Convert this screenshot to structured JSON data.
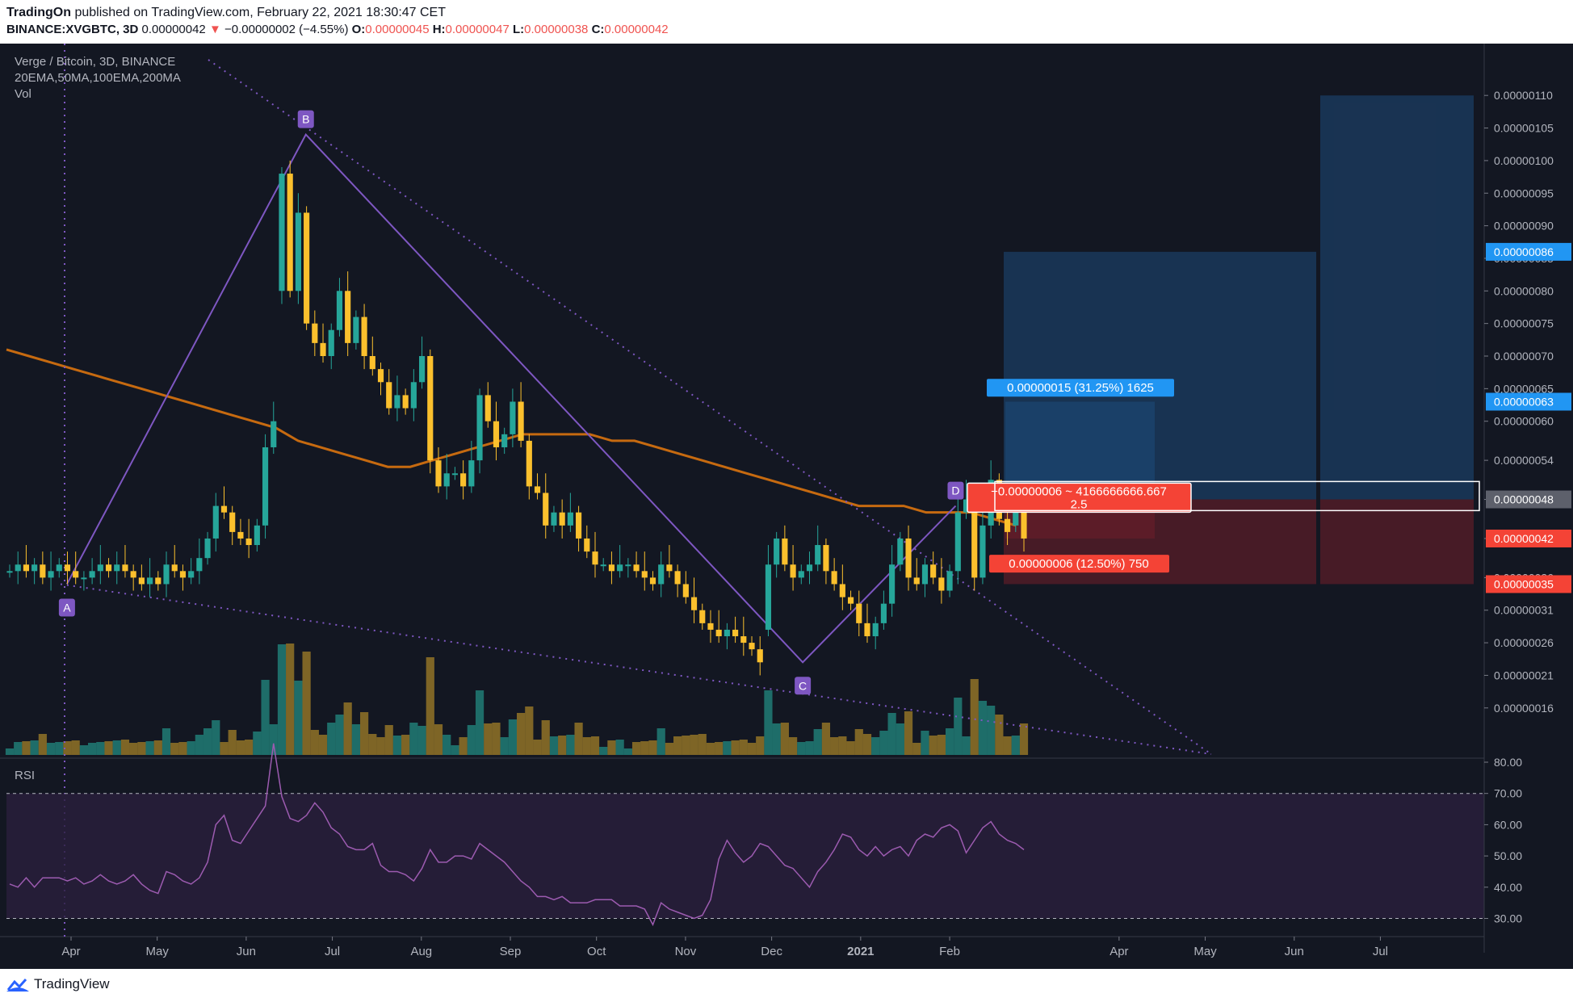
{
  "header": {
    "author": "TradingOn",
    "published_text": "published on TradingView.com, February 22, 2021 18:30:47 CET",
    "symbol": "BINANCE:XVGBTC, 3D",
    "last_price": "0.00000042",
    "change_arrow": "▼",
    "change": "−0.00000002 (−4.55%)",
    "open_label": "O:",
    "open": "0.00000045",
    "high_label": "H:",
    "high": "0.00000047",
    "low_label": "L:",
    "low": "0.00000038",
    "close_label": "C:",
    "close": "0.00000042"
  },
  "legend": {
    "title": "Verge / Bitcoin, 3D, BINANCE",
    "indicators": "20EMA,50MA,100EMA,200MA",
    "volume": "Vol"
  },
  "rsi_label": "RSI",
  "footer": {
    "brand": "TradingView"
  },
  "colors": {
    "background": "#131722",
    "up": "#26a69a",
    "down": "#fbc02d",
    "ma_line": "#c66a10",
    "pattern": "#7e57c2",
    "rsi_line": "#9c5bb0",
    "target_label": "#2196f3",
    "stop_label": "#f44336"
  },
  "position_tool": {
    "target_label": "0.00000015 (31.25%) 1625",
    "stop_label": "0.00000006 (12.50%) 750",
    "center_label_line1": "−0.00000006 ~ 4166666666.667",
    "center_label_line2": "2.5"
  },
  "price_badges": [
    {
      "text": "0.00000086",
      "value": 86,
      "color": "#2196f3"
    },
    {
      "text": "0.00000063",
      "value": 63,
      "color": "#2196f3"
    },
    {
      "text": "0.00000048",
      "value": 48,
      "color": "#5d606b"
    },
    {
      "text": "0.00000042",
      "value": 42,
      "color": "#f44336"
    },
    {
      "text": "0.00000035",
      "value": 35,
      "color": "#f44336"
    }
  ],
  "harmonic_points": [
    {
      "label": "A",
      "date": "2020-03-31",
      "price": 35
    },
    {
      "label": "B",
      "date": "2020-06-14",
      "price": 104
    },
    {
      "label": "C",
      "date": "2020-11-17",
      "price": 23
    },
    {
      "label": "D",
      "date": "2021-01-04",
      "price": 47
    }
  ],
  "chart_data": {
    "type": "candlestick",
    "title": "Verge / Bitcoin, 3D, BINANCE",
    "price_unit": "BTC (values ×1e-8 satoshi)",
    "y_ticks": [
      "0.00000110",
      "0.00000105",
      "0.00000100",
      "0.00000095",
      "0.00000090",
      "0.00000085",
      "0.00000080",
      "0.00000075",
      "0.00000070",
      "0.00000065",
      "0.00000060",
      "0.00000054",
      "0.00000048",
      "0.00000042",
      "0.00000036",
      "0.00000031",
      "0.00000026",
      "0.00000021",
      "0.00000016"
    ],
    "x_ticks": [
      "Apr",
      "May",
      "Jun",
      "Jul",
      "Aug",
      "Sep",
      "Oct",
      "Nov",
      "Dec",
      "2021",
      "Feb",
      "Apr",
      "May",
      "Jun",
      "Jul"
    ],
    "rsi_ticks": [
      "80.00",
      "70.00",
      "60.00",
      "50.00",
      "40.00",
      "30.00"
    ],
    "rsi_levels": [
      70,
      30
    ],
    "ylim": [
      15,
      111
    ],
    "close_sats": [
      37,
      38,
      37,
      38,
      36,
      37,
      38,
      37,
      36,
      36,
      37,
      38,
      37,
      38,
      37,
      36,
      35,
      36,
      35,
      38,
      37,
      36,
      37,
      39,
      42,
      47,
      46,
      43,
      42,
      41,
      44,
      56,
      60,
      98,
      80,
      92,
      75,
      72,
      70,
      74,
      80,
      72,
      76,
      70,
      68,
      66,
      62,
      64,
      62,
      66,
      70,
      54,
      50,
      52,
      52,
      50,
      54,
      64,
      60,
      56,
      58,
      63,
      57,
      50,
      49,
      44,
      46,
      44,
      46,
      42,
      40,
      38,
      38,
      37,
      38,
      38,
      37,
      36,
      35,
      38,
      37,
      35,
      33,
      31,
      29,
      28,
      27,
      28,
      27,
      26,
      25,
      23,
      38,
      42,
      38,
      36,
      37,
      38,
      41,
      37,
      35,
      33,
      32,
      29,
      27,
      29,
      32,
      38,
      42,
      36,
      35,
      38,
      36,
      34,
      37,
      46,
      48,
      36,
      44,
      51,
      45,
      43,
      46,
      42
    ],
    "open_sats": [
      37,
      37,
      38,
      37,
      38,
      36,
      37,
      38,
      37,
      36,
      36,
      37,
      38,
      37,
      38,
      37,
      36,
      35,
      36,
      35,
      38,
      37,
      36,
      37,
      39,
      42,
      47,
      46,
      43,
      42,
      41,
      44,
      56,
      80,
      98,
      80,
      92,
      75,
      72,
      70,
      74,
      80,
      72,
      76,
      70,
      68,
      66,
      62,
      64,
      62,
      66,
      70,
      54,
      50,
      52,
      52,
      50,
      54,
      64,
      60,
      56,
      58,
      63,
      57,
      50,
      49,
      44,
      46,
      44,
      46,
      42,
      40,
      38,
      38,
      37,
      38,
      38,
      37,
      36,
      35,
      38,
      37,
      35,
      33,
      31,
      29,
      28,
      27,
      28,
      27,
      26,
      25,
      28,
      38,
      42,
      38,
      36,
      37,
      38,
      41,
      37,
      35,
      33,
      32,
      29,
      27,
      29,
      32,
      38,
      42,
      36,
      35,
      38,
      36,
      34,
      37,
      46,
      48,
      36,
      44,
      51,
      45,
      44,
      46
    ],
    "ma100_sats": [
      71,
      70,
      69,
      68,
      67,
      66,
      65,
      64,
      63,
      62,
      61,
      60,
      59,
      57,
      56,
      55,
      54,
      53,
      53,
      54,
      55,
      56,
      57,
      58,
      58,
      58,
      58,
      57,
      57,
      56,
      55,
      54,
      53,
      52,
      51,
      50,
      49,
      48,
      47,
      47,
      47,
      46,
      46,
      46,
      45,
      44
    ],
    "rsi": [
      41,
      40,
      43,
      40,
      43,
      43,
      43,
      42,
      43,
      41,
      42,
      44,
      42,
      41,
      42,
      44,
      41,
      39,
      38,
      45,
      44,
      42,
      41,
      43,
      48,
      60,
      63,
      55,
      54,
      58,
      62,
      66,
      86,
      69,
      62,
      61,
      63,
      67,
      64,
      59,
      57,
      53,
      52,
      52,
      54,
      47,
      45,
      45,
      44,
      42,
      46,
      52,
      48,
      48,
      50,
      50,
      49,
      54,
      52,
      50,
      48,
      45,
      42,
      40,
      37,
      37,
      36,
      37,
      35,
      35,
      35,
      36,
      36,
      36,
      34,
      34,
      34,
      33,
      28,
      35,
      33,
      32,
      31,
      30,
      31,
      36,
      49,
      55,
      51,
      48,
      50,
      54,
      53,
      50,
      47,
      46,
      43,
      40,
      45,
      48,
      52,
      57,
      56,
      52,
      50,
      53,
      50,
      52,
      53,
      50,
      55,
      57,
      56,
      59,
      60,
      58,
      51,
      55,
      59,
      61,
      57,
      55,
      54,
      52
    ]
  }
}
